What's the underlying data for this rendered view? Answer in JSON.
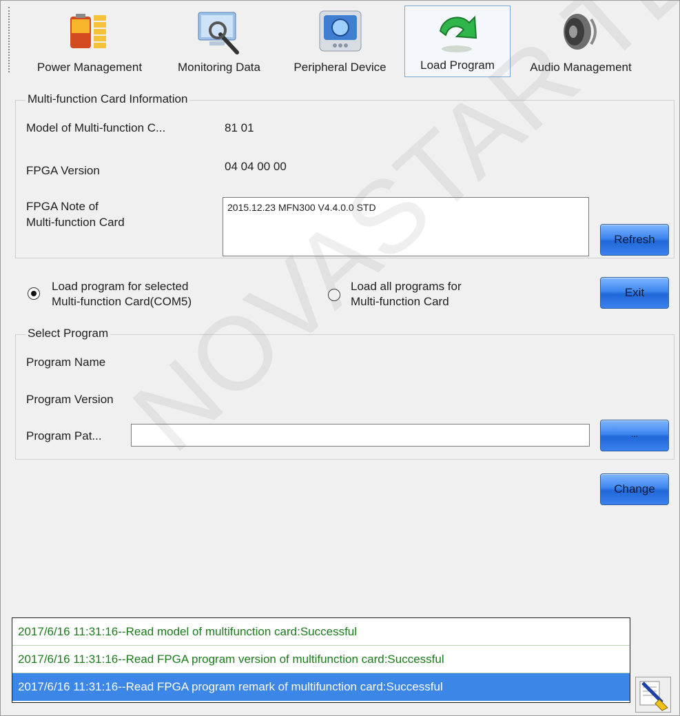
{
  "toolbar": {
    "items": [
      {
        "label": "Power Management",
        "icon": "power-management-icon"
      },
      {
        "label": "Monitoring Data",
        "icon": "monitoring-data-icon"
      },
      {
        "label": "Peripheral Device",
        "icon": "peripheral-device-icon"
      },
      {
        "label": "Load Program",
        "icon": "load-program-icon",
        "active": true
      },
      {
        "label": "Audio Management",
        "icon": "audio-management-icon"
      }
    ]
  },
  "card_info": {
    "legend": "Multi-function Card Information",
    "model_label": "Model of Multi-function C...",
    "model_value": "81 01",
    "fpga_version_label": "FPGA Version",
    "fpga_version_value": "04 04 00 00",
    "fpga_note_label_line1": "FPGA Note of",
    "fpga_note_label_line2": "Multi-function Card",
    "fpga_note_value": "2015.12.23 MFN300 V4.4.0.0 STD",
    "refresh_label": "Refresh"
  },
  "load_options": {
    "selected_line1": "Load program for selected",
    "selected_line2": "Multi-function Card(COM5)",
    "all_line1": "Load all programs for",
    "all_line2": "Multi-function Card",
    "selected_checked": true,
    "exit_label": "Exit"
  },
  "select_program": {
    "legend": "Select Program",
    "name_label": "Program Name",
    "version_label": "Program Version",
    "path_label": "Program Pat...",
    "path_value": "",
    "browse_label": "...",
    "change_label": "Change"
  },
  "log": {
    "entries": [
      "2017/6/16 11:31:16--Read model of multifunction card:Successful",
      "2017/6/16 11:31:16--Read FPGA program version of multifunction card:Successful",
      "2017/6/16 11:31:16--Read FPGA program remark of multifunction card:Successful"
    ],
    "selected_index": 2
  },
  "watermark": "NOVASTAR TECH CO., LTD",
  "colors": {
    "button_blue": "#3d86f0",
    "log_text_green": "#1c7a1c",
    "log_selected_bg": "#3b86e6"
  }
}
